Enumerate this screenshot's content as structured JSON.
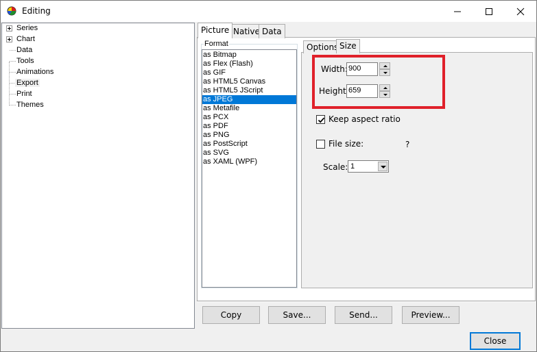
{
  "window": {
    "title": "Editing"
  },
  "tree": {
    "items": [
      {
        "label": "Series",
        "expandable": true
      },
      {
        "label": "Chart",
        "expandable": true
      },
      {
        "label": "Data",
        "expandable": false
      },
      {
        "label": "Tools",
        "expandable": false
      },
      {
        "label": "Animations",
        "expandable": false
      },
      {
        "label": "Export",
        "expandable": false,
        "selected": true
      },
      {
        "label": "Print",
        "expandable": false
      },
      {
        "label": "Themes",
        "expandable": false
      }
    ]
  },
  "tabs": [
    {
      "label": "Picture",
      "active": true
    },
    {
      "label": "Native",
      "active": false
    },
    {
      "label": "Data",
      "active": false
    }
  ],
  "format": {
    "legend": "Format",
    "selected_index": 4,
    "items": [
      "as Bitmap",
      "as Flex (Flash)",
      "as GIF",
      "as HTML5 Canvas",
      "as HTML5 JScript",
      "as JPEG",
      "as Metafile",
      "as PCX",
      "as PDF",
      "as PNG",
      "as PostScript",
      "as SVG",
      "as XAML (WPF)"
    ]
  },
  "inner_tabs": [
    {
      "label": "Options",
      "active": false
    },
    {
      "label": "Size",
      "active": true
    }
  ],
  "size": {
    "width_label": "Width:",
    "width_value": "900",
    "height_label": "Height:",
    "height_value": "659",
    "keep_aspect_label": "Keep aspect ratio",
    "keep_aspect_checked": true,
    "file_size_label": "File size:",
    "file_size_checked": false,
    "file_size_value": "?",
    "scale_label": "Scale:",
    "scale_value": "1"
  },
  "buttons": {
    "copy": "Copy",
    "save": "Save...",
    "send": "Send...",
    "preview": "Preview...",
    "close": "Close"
  },
  "colors": {
    "selection": "#0078d7",
    "highlight_box": "#e0202a"
  }
}
